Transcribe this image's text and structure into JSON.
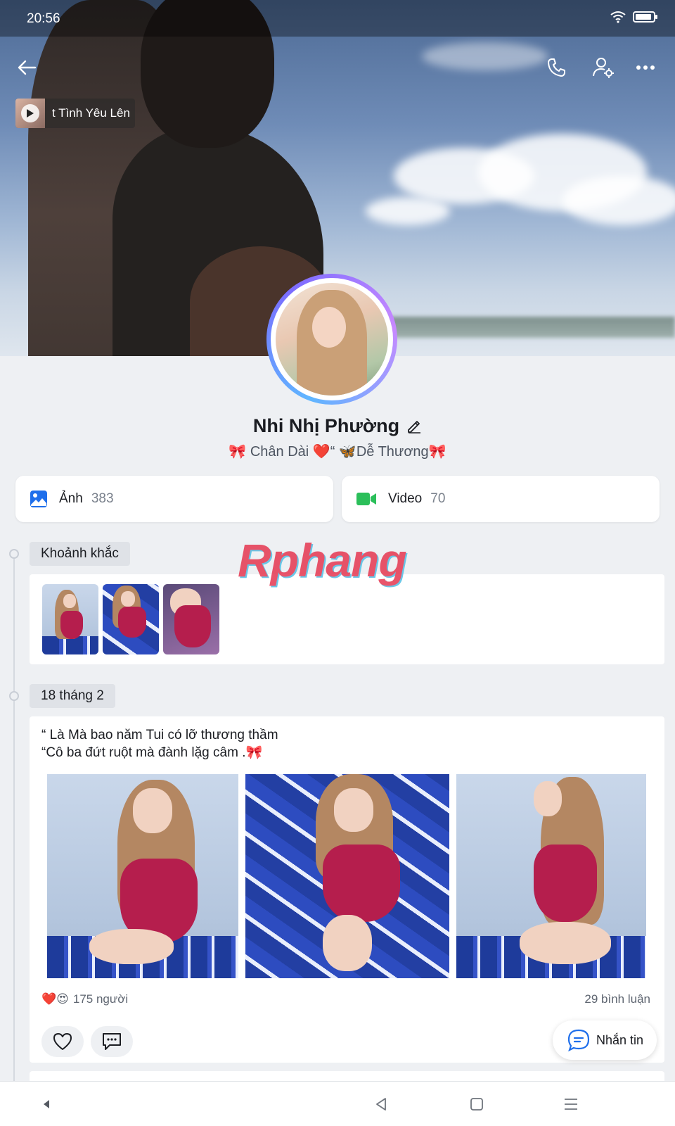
{
  "status_bar": {
    "time": "20:56"
  },
  "header": {
    "music_title": "t Tình Yêu Lên"
  },
  "profile": {
    "name": "Nhi Nhị Phường",
    "bio": "🎀 Chân Dài ❤️“ 🦋Dễ Thương🎀"
  },
  "media": {
    "photos_label": "Ảnh",
    "photos_count": "383",
    "videos_label": "Video",
    "videos_count": "70"
  },
  "moments": {
    "label": "Khoảnh khắc"
  },
  "post": {
    "date": "18 tháng 2",
    "line1": "“ Là Mà bao năm Tui có lỡ thương thầm",
    "line2": "“Cô ba đứt ruột mà đành lặg câm .🎀",
    "reactions_emoji": "❤️😍",
    "reactions_count": "175 người",
    "comments_count": "29 bình luận"
  },
  "chat_button": {
    "label": "Nhắn tin"
  },
  "watermark": "Rphang",
  "colors": {
    "accent": "#1f6feb",
    "video": "#2bbf5a",
    "watermark_red": "#e6425a"
  }
}
